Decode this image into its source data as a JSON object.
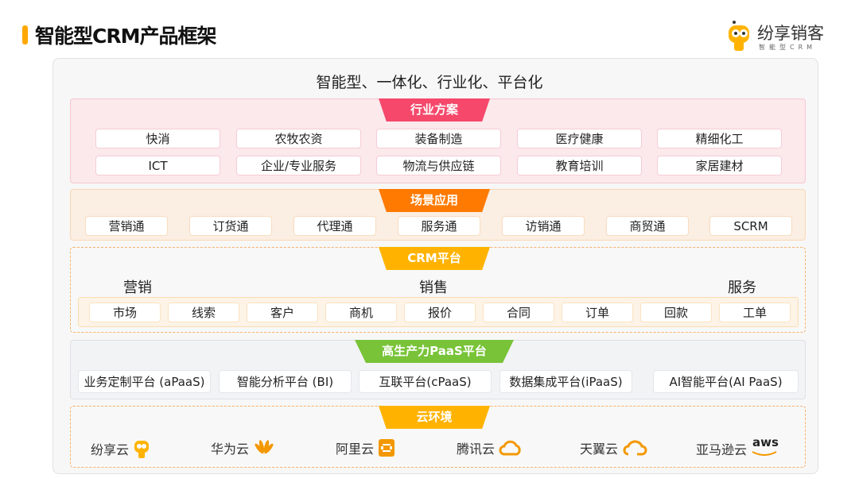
{
  "header": {
    "title": "智能型CRM产品框架",
    "logo_name": "纷享销客",
    "logo_sub": "智能型CRM"
  },
  "subtitle": "智能型、一体化、行业化、平台化",
  "industry": {
    "label": "行业方案",
    "items": [
      "快消",
      "农牧农资",
      "装备制造",
      "医疗健康",
      "精细化工",
      "ICT",
      "企业/专业服务",
      "物流与供应链",
      "教育培训",
      "家居建材"
    ]
  },
  "scenario": {
    "label": "场景应用",
    "items": [
      "营销通",
      "订货通",
      "代理通",
      "服务通",
      "访销通",
      "商贸通",
      "SCRM"
    ]
  },
  "crm": {
    "label": "CRM平台",
    "groups": [
      "营销",
      "销售",
      "服务"
    ],
    "items": [
      "市场",
      "线索",
      "客户",
      "商机",
      "报价",
      "合同",
      "订单",
      "回款",
      "工单"
    ]
  },
  "paas": {
    "label": "高生产力PaaS平台",
    "items": [
      "业务定制平台 (aPaaS)",
      "智能分析平台 (BI)",
      "互联平台(cPaaS)",
      "数据集成平台(iPaaS)",
      "AI智能平台(AI PaaS)"
    ]
  },
  "cloud": {
    "label": "云环境",
    "items": [
      "纷享云",
      "华为云",
      "阿里云",
      "腾讯云",
      "天翼云",
      "亚马逊云"
    ],
    "aws_text": "aws"
  },
  "colors": {
    "industry": "#f5486a",
    "scenario": "#ff7a00",
    "crm": "#ffb300",
    "paas": "#78c337",
    "cloud": "#ffb300"
  }
}
